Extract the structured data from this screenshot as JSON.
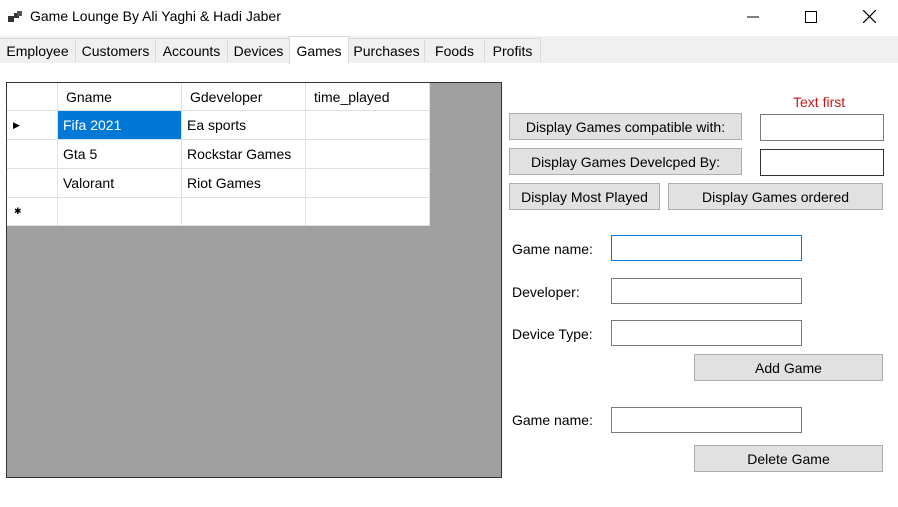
{
  "window": {
    "title": "Game Lounge By Ali Yaghi & Hadi Jaber",
    "minimize_glyph": "—",
    "maximize_glyph": "☐",
    "close_glyph": "✕"
  },
  "tabs": [
    {
      "label": "Employee",
      "active": false
    },
    {
      "label": "Customers",
      "active": false
    },
    {
      "label": "Accounts",
      "active": false
    },
    {
      "label": "Devices",
      "active": false
    },
    {
      "label": "Games",
      "active": true
    },
    {
      "label": "Purchases",
      "active": false
    },
    {
      "label": "Foods",
      "active": false
    },
    {
      "label": "Profits",
      "active": false
    }
  ],
  "grid": {
    "columns": [
      "Gname",
      "Gdeveloper",
      "time_played"
    ],
    "rows": [
      {
        "Gname": "Fifa 2021",
        "Gdeveloper": "Ea sports",
        "time_played": "",
        "selected": true
      },
      {
        "Gname": "Gta 5",
        "Gdeveloper": "Rockstar Games",
        "time_played": "",
        "selected": false
      },
      {
        "Gname": "Valorant",
        "Gdeveloper": "Riot Games",
        "time_played": "",
        "selected": false
      }
    ],
    "current_row_glyph": "▶",
    "new_row_glyph": "✱",
    "background_color": "#a0a0a0",
    "selection_color": "#0078d7"
  },
  "controls": {
    "text_first_label": "Text first",
    "display_compatible_button": "Display Games compatible with:",
    "compatible_input_value": "",
    "display_developed_button": "Display Games Develcped By:",
    "developed_input_value": "",
    "display_most_played_button": "Display Most Played",
    "display_ordered_button": "Display Games ordered",
    "add_form": {
      "game_name_label": "Game name:",
      "game_name_value": "",
      "developer_label": "Developer:",
      "developer_value": "",
      "device_type_label": "Device Type:",
      "device_type_value": "",
      "add_button": "Add Game"
    },
    "delete_form": {
      "game_name_label": "Game name:",
      "game_name_value": "",
      "delete_button": "Delete Game"
    }
  }
}
